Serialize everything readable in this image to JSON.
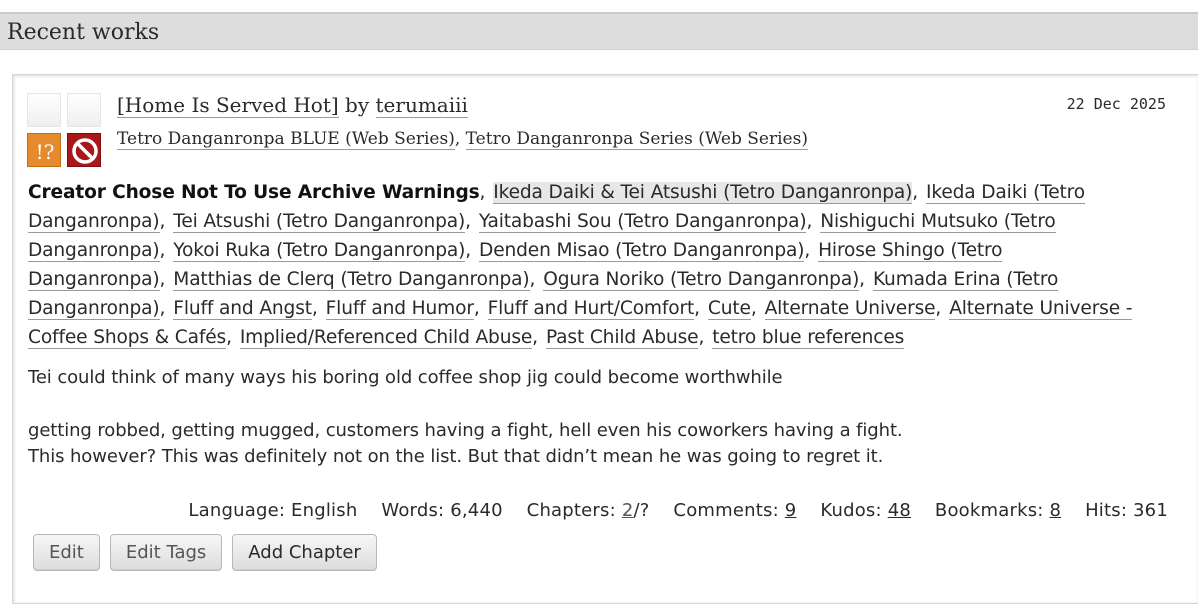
{
  "section": {
    "title": "Recent works"
  },
  "work": {
    "title": "[Home Is Served Hot]",
    "by": "by",
    "author": "terumaiii",
    "date": "22 Dec 2025",
    "fandoms": [
      "Tetro Danganronpa BLUE (Web Series)",
      "Tetro Danganronpa Series (Web Series)"
    ],
    "required_tags": {
      "icons": [
        "rating-not-rated-icon",
        "category-none-icon",
        "warning-choose-not-icon",
        "complete-no-icon"
      ],
      "warning_symbol": "!?"
    },
    "tags": [
      "Creator Chose Not To Use Archive Warnings",
      "Ikeda Daiki & Tei Atsushi (Tetro Danganronpa)",
      "Ikeda Daiki (Tetro Danganronpa)",
      "Tei Atsushi (Tetro Danganronpa)",
      "Yaitabashi Sou (Tetro Danganronpa)",
      "Nishiguchi Mutsuko (Tetro Danganronpa)",
      "Yokoi Ruka (Tetro Danganronpa)",
      "Denden Misao (Tetro Danganronpa)",
      "Hirose Shingo (Tetro Danganronpa)",
      "Matthias de Clerq (Tetro Danganronpa)",
      "Ogura Noriko (Tetro Danganronpa)",
      "Kumada Erina (Tetro Danganronpa)",
      "Fluff and Angst",
      "Fluff and Humor",
      "Fluff and Hurt/Comfort",
      "Cute",
      "Alternate Universe",
      "Alternate Universe - Coffee Shops & Cafés",
      "Implied/Referenced Child Abuse",
      "Past Child Abuse",
      "tetro blue references"
    ],
    "summary": [
      "Tei could think of many ways his boring old coffee shop jig could become worthwhile",
      "getting robbed, getting mugged, customers having a fight, hell even his coworkers having a fight.",
      "This however? This was definitely not on the list. But that didn’t mean he was going to regret it."
    ],
    "stats": {
      "language_label": "Language:",
      "language": "English",
      "words_label": "Words:",
      "words": "6,440",
      "chapters_label": "Chapters:",
      "chapters_current": "2",
      "chapters_total": "/?",
      "comments_label": "Comments:",
      "comments": "9",
      "kudos_label": "Kudos:",
      "kudos": "48",
      "bookmarks_label": "Bookmarks:",
      "bookmarks": "8",
      "hits_label": "Hits:",
      "hits": "361"
    },
    "actions": {
      "edit": "Edit",
      "edit_tags": "Edit Tags",
      "add_chapter": "Add Chapter"
    }
  }
}
